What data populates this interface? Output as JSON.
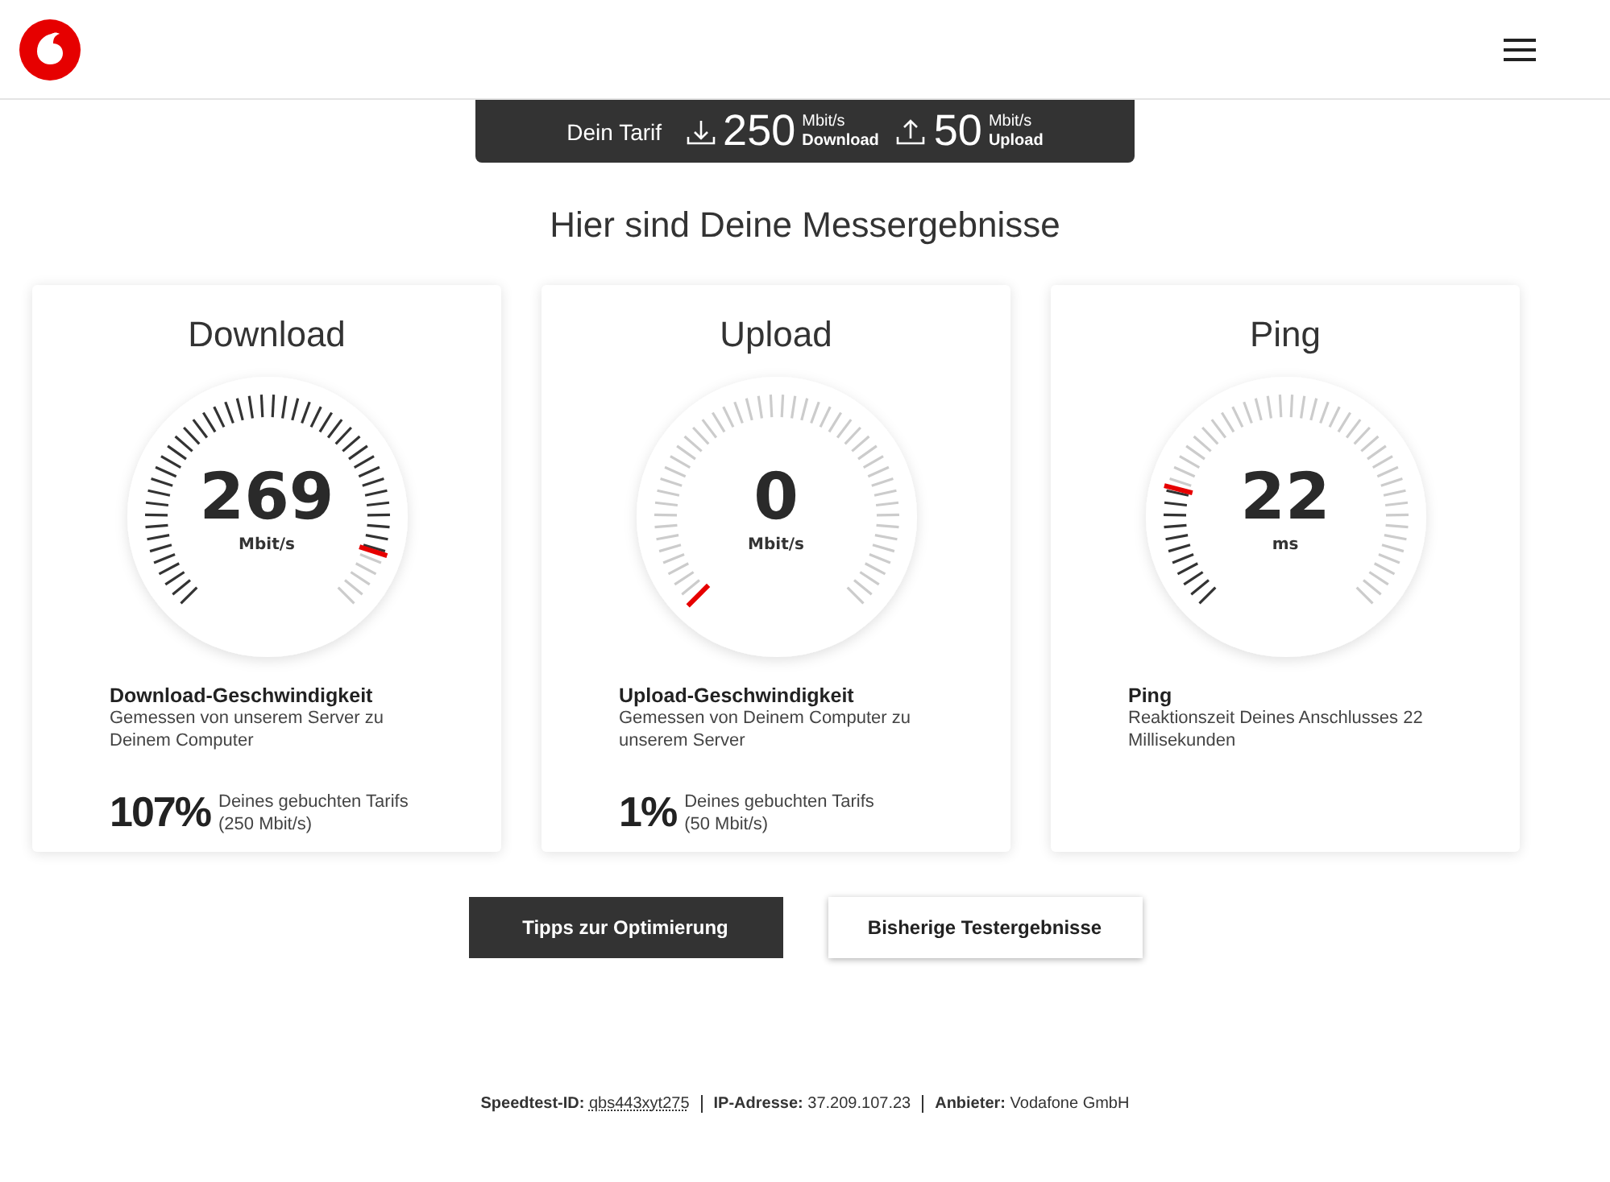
{
  "tariff": {
    "label": "Dein Tarif",
    "download": {
      "value": "250",
      "unit": "Mbit/s",
      "caption": "Download"
    },
    "upload": {
      "value": "50",
      "unit": "Mbit/s",
      "caption": "Upload"
    }
  },
  "heading": "Hier sind Deine Messergebnisse",
  "cards": [
    {
      "title": "Download",
      "value": "269",
      "unit": "Mbit/s",
      "subtitle": "Download-Geschwindigkeit",
      "description": "Gemessen von unserem Server zu Deinem Computer",
      "percent": "107%",
      "percent_label": "Deines gebuchten Tarifs",
      "percent_detail": "(250 Mbit/s)"
    },
    {
      "title": "Upload",
      "value": "0",
      "unit": "Mbit/s",
      "subtitle": "Upload-Geschwindigkeit",
      "description": "Gemessen von Deinem Computer zu unserem Server",
      "percent": "1%",
      "percent_label": "Deines gebuchten Tarifs",
      "percent_detail": "(50 Mbit/s)"
    },
    {
      "title": "Ping",
      "value": "22",
      "unit": "ms",
      "subtitle": "Ping",
      "description": "Reaktionszeit Deines Anschlusses 22 Millisekunden"
    }
  ],
  "buttons": [
    {
      "label": "Tipps zur Optimierung",
      "kind": "primary"
    },
    {
      "label": "Bisherige Testergebnisse",
      "kind": "secondary"
    }
  ],
  "footer": [
    {
      "label": "Speedtest-ID:",
      "value": "qbs443xyt275",
      "kind": "link"
    },
    {
      "label": "IP-Adresse:",
      "value": "37.209.107.23",
      "kind": "text"
    },
    {
      "label": "Anbieter:",
      "value": "Vodafone GmbH",
      "kind": "text"
    }
  ]
}
